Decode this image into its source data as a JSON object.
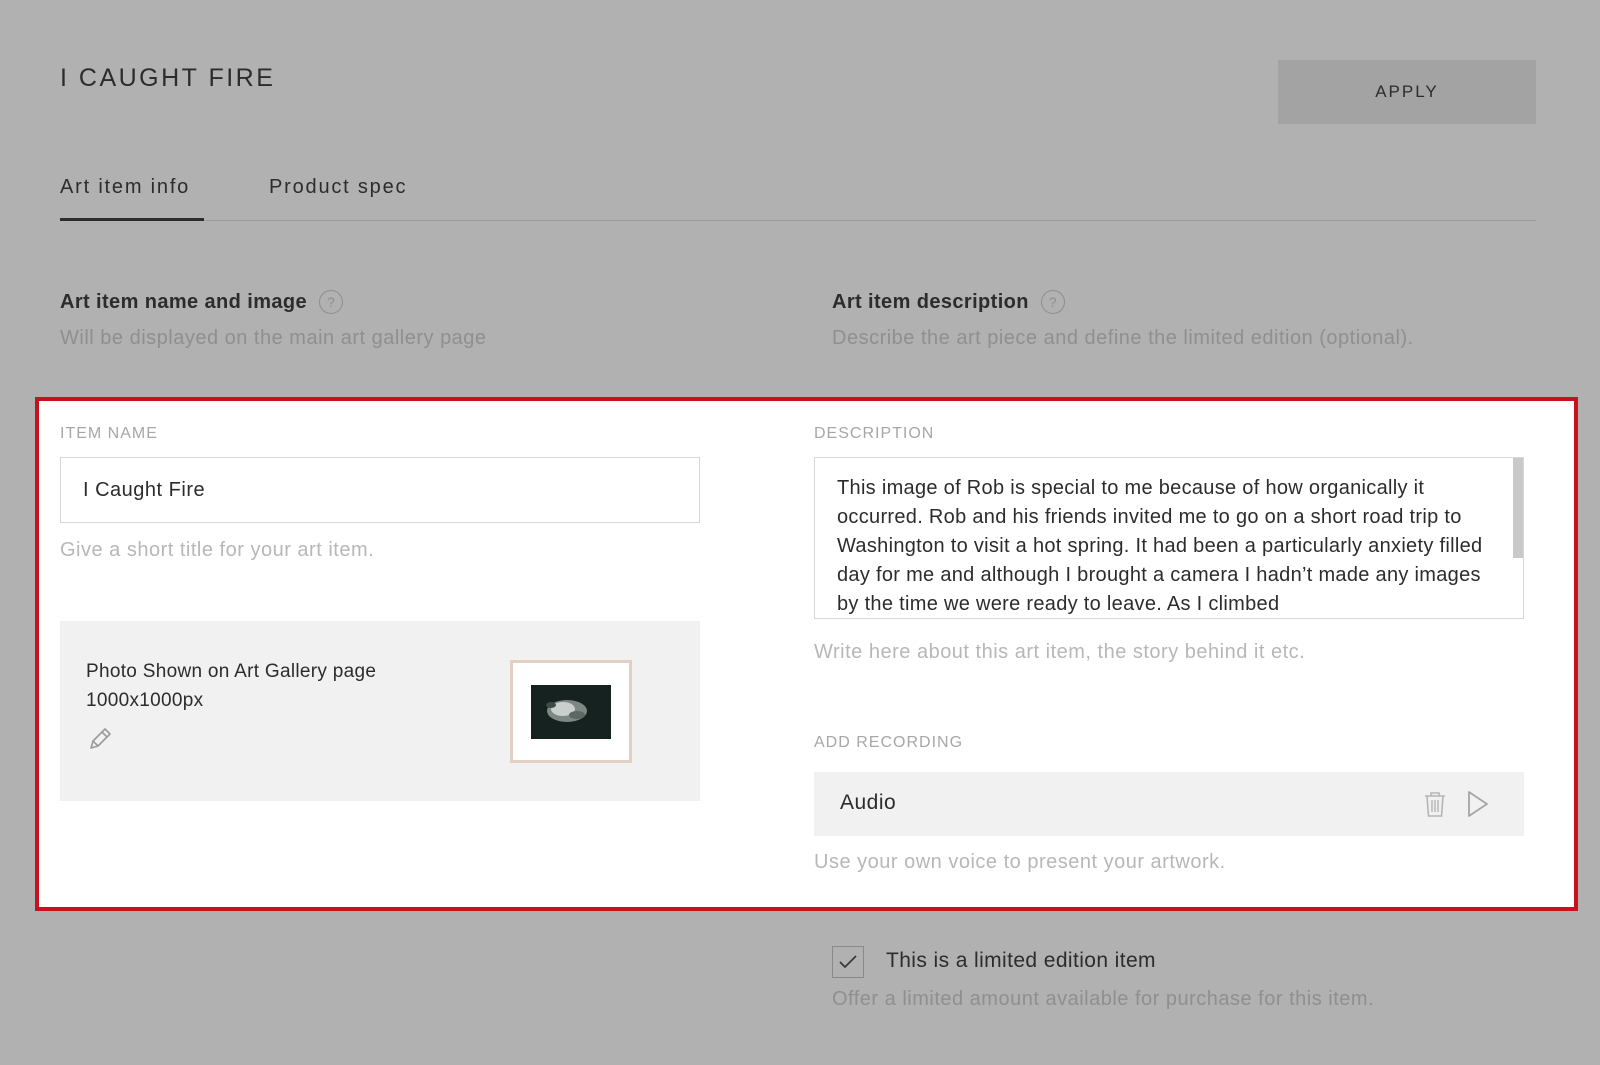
{
  "header": {
    "title": "I CAUGHT FIRE",
    "apply_label": "APPLY"
  },
  "tabs": [
    {
      "label": "Art item info",
      "active": true
    },
    {
      "label": "Product spec",
      "active": false
    }
  ],
  "left_section": {
    "heading": "Art item name and image",
    "help_icon": "?",
    "subtitle": "Will be displayed on the main art gallery page"
  },
  "right_section": {
    "heading": "Art item description",
    "help_icon": "?",
    "subtitle": "Describe the art piece and define the limited edition (optional)."
  },
  "item_name": {
    "label": "ITEM NAME",
    "value": "I Caught Fire",
    "helper": "Give a short title for your art item."
  },
  "photo": {
    "caption_line1": "Photo Shown on Art Gallery page",
    "caption_line2": "1000x1000px",
    "edit_icon": "pencil-icon"
  },
  "description": {
    "label": "DESCRIPTION",
    "value": "This image of Rob is special to me because of how organically it occurred. Rob and his friends invited me to go on a short road trip to Washington to visit a hot spring. It had been a particularly anxiety filled day for me and although I brought a camera I hadn’t made any images by the time we were ready to leave. As I climbed",
    "helper": "Write here about this art item, the story behind it etc."
  },
  "recording": {
    "label": "ADD RECORDING",
    "audio_label": "Audio",
    "helper": "Use your own voice to present your artwork.",
    "icons": [
      "trash-icon",
      "play-icon"
    ]
  },
  "limited_edition": {
    "checked": true,
    "label": "This is a limited edition item",
    "helper": "Offer a limited amount available for purchase for this item."
  },
  "colors": {
    "background_overlay": "#b1b1b1",
    "highlight_border": "#c8111e",
    "panel_background": "#ffffff"
  }
}
